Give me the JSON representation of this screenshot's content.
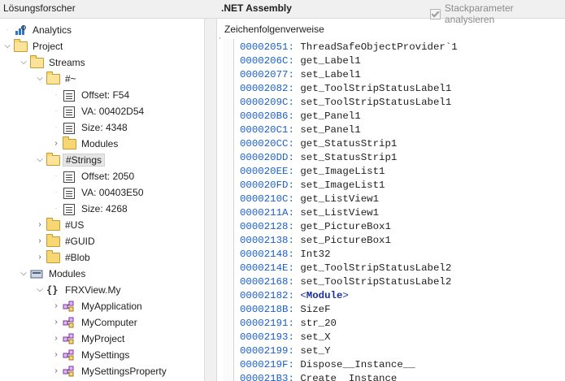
{
  "header": {
    "left_title": "Lösungsforscher",
    "center_title": ".NET Assembly",
    "stack_toggle_label": "Stackparameter analysieren"
  },
  "tree": {
    "items": [
      {
        "label": "Analytics",
        "level": 0,
        "icon": "analytics-icon",
        "expander": "none"
      },
      {
        "label": "Project",
        "level": 0,
        "icon": "folder-open-icon",
        "expander": "down"
      },
      {
        "label": "Streams",
        "level": 1,
        "icon": "folder-open-icon",
        "expander": "down"
      },
      {
        "label": "#~",
        "level": 2,
        "icon": "folder-open-icon",
        "expander": "down"
      },
      {
        "label": "Offset: F54",
        "level": 3,
        "icon": "property-icon",
        "expander": "none"
      },
      {
        "label": "VA: 00402D54",
        "level": 3,
        "icon": "property-icon",
        "expander": "none"
      },
      {
        "label": "Size: 4348",
        "level": 3,
        "icon": "property-icon",
        "expander": "none"
      },
      {
        "label": "Modules",
        "level": 3,
        "icon": "folder-icon",
        "expander": "right"
      },
      {
        "label": "#Strings",
        "level": 2,
        "icon": "folder-open-icon",
        "expander": "down",
        "selected": true
      },
      {
        "label": "Offset: 2050",
        "level": 3,
        "icon": "property-icon",
        "expander": "none"
      },
      {
        "label": "VA: 00403E50",
        "level": 3,
        "icon": "property-icon",
        "expander": "none"
      },
      {
        "label": "Size: 4268",
        "level": 3,
        "icon": "property-icon",
        "expander": "none"
      },
      {
        "label": "#US",
        "level": 2,
        "icon": "folder-icon",
        "expander": "right"
      },
      {
        "label": "#GUID",
        "level": 2,
        "icon": "folder-icon",
        "expander": "right"
      },
      {
        "label": "#Blob",
        "level": 2,
        "icon": "folder-icon",
        "expander": "right"
      },
      {
        "label": "Modules",
        "level": 1,
        "icon": "module-icon",
        "expander": "down"
      },
      {
        "label": "FRXView.My",
        "level": 2,
        "icon": "namespace-icon",
        "expander": "down"
      },
      {
        "label": "MyApplication",
        "level": 3,
        "icon": "class-icon",
        "expander": "right"
      },
      {
        "label": "MyComputer",
        "level": 3,
        "icon": "class-icon",
        "expander": "right"
      },
      {
        "label": "MyProject",
        "level": 3,
        "icon": "class-icon",
        "expander": "right"
      },
      {
        "label": "MySettings",
        "level": 3,
        "icon": "class-icon",
        "expander": "right"
      },
      {
        "label": "MySettingsProperty",
        "level": 3,
        "icon": "class-icon",
        "expander": "right"
      }
    ]
  },
  "tabs": [
    {
      "label": "Zeichenfolgenverweise",
      "active": true
    }
  ],
  "code": {
    "lines": [
      {
        "addr": "00002051:",
        "text": "ThreadSafeObjectProvider`1"
      },
      {
        "addr": "0000206C:",
        "text": "get_Label1"
      },
      {
        "addr": "00002077:",
        "text": "set_Label1"
      },
      {
        "addr": "00002082:",
        "text": "get_ToolStripStatusLabel1"
      },
      {
        "addr": "0000209C:",
        "text": "set_ToolStripStatusLabel1"
      },
      {
        "addr": "000020B6:",
        "text": "get_Panel1"
      },
      {
        "addr": "000020C1:",
        "text": "set_Panel1"
      },
      {
        "addr": "000020CC:",
        "text": "get_StatusStrip1"
      },
      {
        "addr": "000020DD:",
        "text": "set_StatusStrip1"
      },
      {
        "addr": "000020EE:",
        "text": "get_ImageList1"
      },
      {
        "addr": "000020FD:",
        "text": "set_ImageList1"
      },
      {
        "addr": "0000210C:",
        "text": "get_ListView1"
      },
      {
        "addr": "0000211A:",
        "text": "set_ListView1"
      },
      {
        "addr": "00002128:",
        "text": "get_PictureBox1"
      },
      {
        "addr": "00002138:",
        "text": "set_PictureBox1"
      },
      {
        "addr": "00002148:",
        "text": "Int32"
      },
      {
        "addr": "0000214E:",
        "text": "get_ToolStripStatusLabel2"
      },
      {
        "addr": "00002168:",
        "text": "set_ToolStripStatusLabel2"
      },
      {
        "addr": "00002182:",
        "text": "<Module>",
        "special": true
      },
      {
        "addr": "0000218B:",
        "text": "SizeF"
      },
      {
        "addr": "00002191:",
        "text": "str_20"
      },
      {
        "addr": "00002193:",
        "text": "set_X"
      },
      {
        "addr": "00002199:",
        "text": "set_Y"
      },
      {
        "addr": "0000219F:",
        "text": "Dispose__Instance__"
      },
      {
        "addr": "000021B3:",
        "text": "Create__Instance__"
      }
    ]
  },
  "colors": {
    "address": "#1a5fcf",
    "module": "#1a2f9e",
    "folder_fill": "#f7d774",
    "folder_border": "#c99a2e"
  }
}
